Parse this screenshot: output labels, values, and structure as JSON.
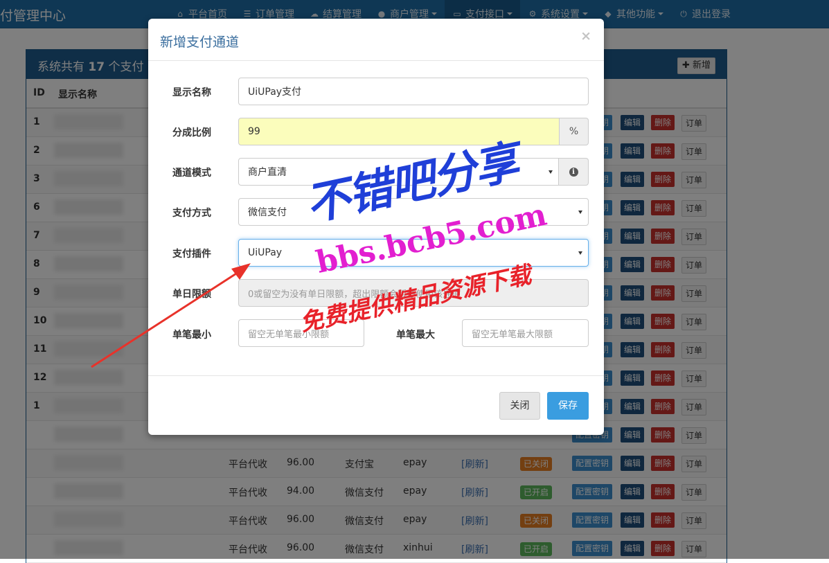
{
  "app": {
    "brand": "付管理中心"
  },
  "nav": [
    {
      "icon": "home-icon",
      "glyph": "⌂",
      "label": "平台首页",
      "dropdown": false,
      "active": false
    },
    {
      "icon": "list-icon",
      "glyph": "☰",
      "label": "订单管理",
      "dropdown": false,
      "active": false
    },
    {
      "icon": "cloud-icon",
      "glyph": "☁",
      "label": "结算管理",
      "dropdown": false,
      "active": false
    },
    {
      "icon": "user-icon",
      "glyph": "●",
      "label": "商户管理",
      "dropdown": true,
      "active": false
    },
    {
      "icon": "card-icon",
      "glyph": "▭",
      "label": "支付接口",
      "dropdown": true,
      "active": true
    },
    {
      "icon": "gear-icon",
      "glyph": "⚙",
      "label": "系统设置",
      "dropdown": true,
      "active": false
    },
    {
      "icon": "cube-icon",
      "glyph": "◆",
      "label": "其他功能",
      "dropdown": true,
      "active": false
    },
    {
      "icon": "power-icon",
      "glyph": "⏻",
      "label": "退出登录",
      "dropdown": false,
      "active": false
    }
  ],
  "panel": {
    "title_prefix": "系统共有 ",
    "count": "17",
    "title_suffix": " 个支付",
    "add_label": "✚ 新增",
    "col_id": "ID",
    "col_name": "显示名称"
  },
  "rows": [
    {
      "id": "1"
    },
    {
      "id": "2"
    },
    {
      "id": "3"
    },
    {
      "id": "6"
    },
    {
      "id": "7"
    },
    {
      "id": "8"
    },
    {
      "id": "9"
    },
    {
      "id": "10"
    },
    {
      "id": "11"
    },
    {
      "id": "12"
    },
    {
      "id": "1"
    },
    {
      "id": ""
    },
    {
      "id": "",
      "mode": "平台代收",
      "rate": "96.00",
      "method": "支付宝",
      "plugin": "epay",
      "refresh": "[刷新]",
      "status": "已关闭",
      "on": false
    },
    {
      "id": "",
      "mode": "平台代收",
      "rate": "94.00",
      "method": "微信支付",
      "plugin": "epay",
      "refresh": "[刷新]",
      "status": "已开启",
      "on": true
    },
    {
      "id": "",
      "mode": "平台代收",
      "rate": "96.00",
      "method": "微信支付",
      "plugin": "epay",
      "refresh": "[刷新]",
      "status": "已关闭",
      "on": false
    },
    {
      "id": "",
      "mode": "平台代收",
      "rate": "96.00",
      "method": "微信支付",
      "plugin": "xinhui",
      "refresh": "[刷新]",
      "status": "已开启",
      "on": true
    }
  ],
  "row_buttons": {
    "key": "配置密钥",
    "edit": "编辑",
    "delete": "删除",
    "order": "订单"
  },
  "modal": {
    "title": "新增支付通道",
    "close_glyph": "×",
    "fields": {
      "name_label": "显示名称",
      "name_value": "UiUPay支付",
      "rate_label": "分成比例",
      "rate_value": "99",
      "rate_unit": "%",
      "mode_label": "通道模式",
      "mode_value": "商户直清",
      "method_label": "支付方式",
      "method_value": "微信支付",
      "plugin_label": "支付插件",
      "plugin_value": "UiUPay",
      "daily_label": "单日限额",
      "daily_placeholder": "0或留空为没有单日限额，超出限额会暂停使用该通道",
      "min_label": "单笔最小",
      "min_placeholder": "留空无单笔最小限额",
      "max_label": "单笔最大",
      "max_placeholder": "留空无单笔最大限额"
    },
    "close_button": "关闭",
    "save_button": "保存"
  },
  "watermark": {
    "line1": "不错吧分享",
    "line2": "bbs.bcb5.com",
    "line3": "免费提供精品资源下载"
  },
  "colors": {
    "navbar": "#1e6fa8",
    "panel_header": "#1f5d8e",
    "save": "#3a9de0",
    "rate_highlight": "#fbfdbc",
    "status_off": "#e67e22",
    "status_on": "#5cb85c"
  }
}
